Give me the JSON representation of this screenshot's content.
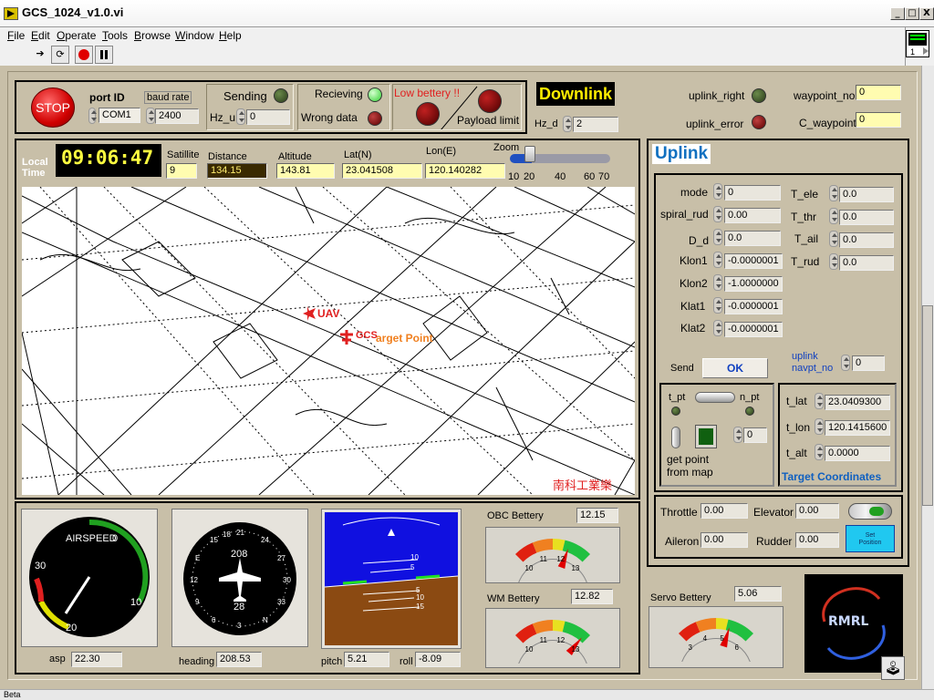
{
  "window": {
    "title": "GCS_1024_v1.0.vi",
    "min": "_",
    "max": "□",
    "close": "X"
  },
  "menu": [
    "File",
    "Edit",
    "Operate",
    "Tools",
    "Browse",
    "Window",
    "Help"
  ],
  "status": {
    "text": "Beta"
  },
  "connection": {
    "stop_label": "STOP",
    "port_label": "port ID",
    "port_value": "COM1",
    "baud_label": "baud rate",
    "baud_value": "2400",
    "sending_label": "Sending",
    "hz_u_label": "Hz_u",
    "hz_u_value": "0",
    "receiving_label": "Recieving",
    "wrong_label": "Wrong data",
    "low_battery_label": "Low bettery !!",
    "payload_label": "Payload limit"
  },
  "downlink": {
    "title": "Downlink",
    "hz_d_label": "Hz_d",
    "hz_d_value": "2",
    "uplink_right_label": "uplink_right",
    "uplink_error_label": "uplink_error",
    "waypoint_no_label": "waypoint_no",
    "waypoint_no_value": "0",
    "c_waypoint_label": "C_waypoint",
    "c_waypoint_value": "0"
  },
  "nav": {
    "local_time_label": "Local\nTime",
    "time": "09:06:47",
    "satellite_label": "Satillite",
    "satellite_value": "9",
    "distance_label": "Distance",
    "distance_value": "134.15",
    "altitude_label": "Altitude",
    "altitude_value": "143.81",
    "lat_label": "Lat(N)",
    "lat_value": "23.041508",
    "lon_label": "Lon(E)",
    "lon_value": "120.140282",
    "zoom_label": "Zoom",
    "zoom_ticks": [
      "10",
      "20",
      "40",
      "60",
      "70"
    ],
    "zoom_value": 20
  },
  "map": {
    "uav_label": "UAV",
    "gcs_label": "GCS",
    "target_label": "arget Point",
    "watermark": "南科工業樂"
  },
  "uplink": {
    "title": "Uplink",
    "params_left": [
      {
        "label": "mode",
        "value": "0"
      },
      {
        "label": "spiral_rud",
        "value": "0.00"
      },
      {
        "label": "D_d",
        "value": "0.0"
      },
      {
        "label": "Klon1",
        "value": "-0.0000001"
      },
      {
        "label": "Klon2",
        "value": "-1.0000000"
      },
      {
        "label": "Klat1",
        "value": "-0.0000001"
      },
      {
        "label": "Klat2",
        "value": "-0.0000001"
      }
    ],
    "params_right": [
      {
        "label": "T_ele",
        "value": "0.0"
      },
      {
        "label": "T_thr",
        "value": "0.0"
      },
      {
        "label": "T_ail",
        "value": "0.0"
      },
      {
        "label": "T_rud",
        "value": "0.0"
      }
    ],
    "send_label": "Send",
    "ok_label": "OK",
    "navpt_label": "uplink\nnavpt_no",
    "navpt_value": "0",
    "t_pt_label": "t_pt",
    "n_pt_label": "n_pt",
    "getpoint_label": "get point\nfrom map",
    "pt_index_value": "0",
    "target": [
      {
        "label": "t_lat",
        "value": "23.0409300"
      },
      {
        "label": "t_lon",
        "value": "120.1415600"
      },
      {
        "label": "t_alt",
        "value": "0.0000"
      }
    ],
    "target_title": "Target Coordinates",
    "servo": [
      {
        "label": "Throttle",
        "value": "0.00"
      },
      {
        "label": "Elevator",
        "value": "0.00"
      },
      {
        "label": "Aileron",
        "value": "0.00"
      },
      {
        "label": "Rudder",
        "value": "0.00"
      }
    ],
    "set_position_label": "Set\nPosition"
  },
  "instruments": {
    "airspeed_title": "AIRSPEED",
    "airspeed_ticks": [
      "0",
      "10",
      "20",
      "30"
    ],
    "asp_label": "asp",
    "asp_value": "22.30",
    "heading_label": "heading",
    "heading_value": "208.53",
    "heading_center": "208",
    "heading_bottom": "28",
    "compass_ticks": [
      "21",
      "24",
      "27",
      "30",
      "33",
      "N",
      "3",
      "6",
      "9",
      "12",
      "E",
      "15",
      "18"
    ],
    "pitch_label": "pitch",
    "pitch_value": "5.21",
    "roll_label": "roll",
    "roll_value": "-8.09",
    "pitch_ticks": [
      "10",
      "5",
      "5",
      "10",
      "15"
    ]
  },
  "batteries": [
    {
      "name": "OBC Bettery",
      "value": "12.15",
      "ticks": [
        "10",
        "11",
        "12",
        "13"
      ],
      "level": 0.72
    },
    {
      "name": "WM Bettery",
      "value": "12.82",
      "ticks": [
        "10",
        "11",
        "12",
        "13"
      ],
      "level": 0.94
    },
    {
      "name": "Servo Bettery",
      "value": "5.06",
      "ticks": [
        "3",
        "4",
        "5",
        "6"
      ],
      "level": 0.69
    }
  ],
  "logo": {
    "text": "RMRL"
  },
  "colors": {
    "panel": "#c8bfa8",
    "indicator_bg": "#fffcb0",
    "uplink_title": "#1070c0",
    "red": "#e02020"
  }
}
